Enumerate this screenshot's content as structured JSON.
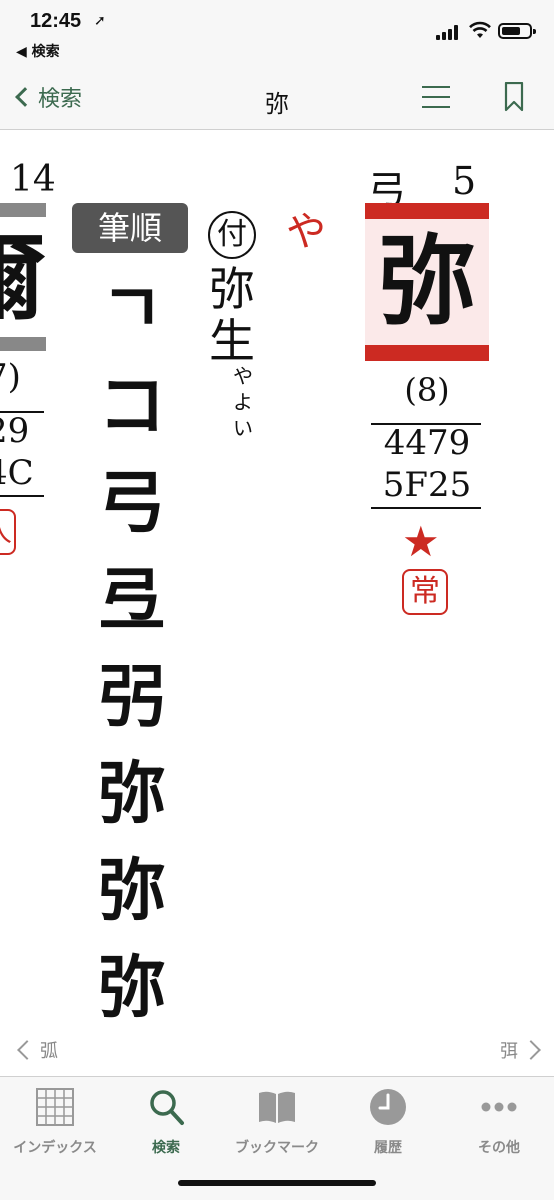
{
  "status": {
    "time": "12:45",
    "back_app": "◀ 検索"
  },
  "nav": {
    "back_label": "検索",
    "title": "弥"
  },
  "entry": {
    "radical": "弓",
    "radical_strokes": "5",
    "kanji": "弥",
    "total_strokes": "(8)",
    "jis_code": "4479",
    "unicode": "5F25",
    "star": "★",
    "jouyou_badge": "常",
    "reading": "や",
    "appendix_mark": "付",
    "nanori_word": "弥生",
    "nanori_reading": "やよい",
    "stroke_order_label": "筆順",
    "stroke_order_steps": [
      "ㄱ",
      "コ",
      "弓",
      "弖",
      "弜",
      "弥",
      "弥",
      "弥"
    ]
  },
  "prev_entry": {
    "radical_strokes": "14",
    "kanji": "爾",
    "total_strokes": "7)",
    "jis_code": "29",
    "unicode": "4C",
    "badge": "人"
  },
  "paging": {
    "prev": "弧",
    "next": "弭"
  },
  "tabs": [
    {
      "label": "インデックス",
      "icon": "grid-icon",
      "active": false
    },
    {
      "label": "検索",
      "icon": "search-icon",
      "active": true
    },
    {
      "label": "ブックマーク",
      "icon": "book-icon",
      "active": false
    },
    {
      "label": "履歴",
      "icon": "clock-icon",
      "active": false
    },
    {
      "label": "その他",
      "icon": "more-icon",
      "active": false
    }
  ],
  "colors": {
    "accent": "#3c6a4f",
    "red": "#cc2a22"
  }
}
